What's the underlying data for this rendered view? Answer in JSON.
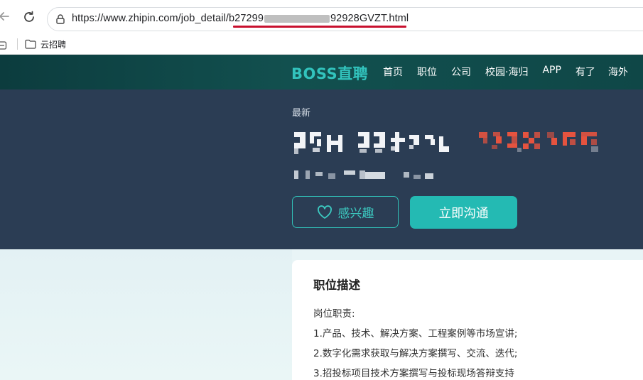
{
  "browser": {
    "url_prefix": "https://www.zhipin.com/job_detail/",
    "url_id_start": "b27299",
    "url_id_end": "92928GVZT",
    "url_suffix": ".html",
    "bookmarks": [
      {
        "label": "云招聘",
        "icon": "folder-icon"
      }
    ]
  },
  "site": {
    "logo": "BOSS直聘",
    "nav": [
      "首页",
      "职位",
      "公司",
      "校园·海归",
      "APP",
      "有了",
      "海外"
    ]
  },
  "job": {
    "tag": "最新",
    "interest_label": "感兴趣",
    "chat_label": "立即沟通"
  },
  "description": {
    "title": "职位描述",
    "lines": [
      "岗位职责:",
      "1.产品、技术、解决方案、工程案例等市场宣讲;",
      "2.数字化需求获取与解决方案撰写、交流、迭代;",
      "3.招投标项目技术方案撰写与投标现场答辩支持"
    ]
  },
  "colors": {
    "header_bg": "#0f4747",
    "hero_bg": "#2b3d54",
    "accent": "#24bab3",
    "url_underline": "#c8102e"
  }
}
